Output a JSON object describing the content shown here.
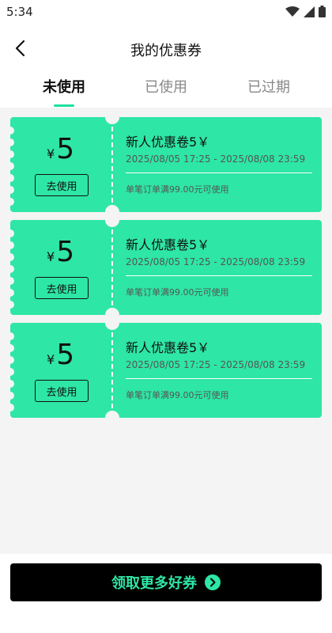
{
  "status_bar": {
    "time": "5:34"
  },
  "header": {
    "title": "我的优惠券"
  },
  "tabs": [
    {
      "label": "未使用",
      "active": true
    },
    {
      "label": "已使用",
      "active": false
    },
    {
      "label": "已过期",
      "active": false
    }
  ],
  "coupons": [
    {
      "currency": "¥",
      "amount": "5",
      "use_label": "去使用",
      "title": "新人优惠卷5￥",
      "validity": "2025/08/05 17:25 - 2025/08/08 23:59",
      "condition": "单笔订单满99.00元可使用"
    },
    {
      "currency": "¥",
      "amount": "5",
      "use_label": "去使用",
      "title": "新人优惠卷5￥",
      "validity": "2025/08/05 17:25 - 2025/08/08 23:59",
      "condition": "单笔订单满99.00元可使用"
    },
    {
      "currency": "¥",
      "amount": "5",
      "use_label": "去使用",
      "title": "新人优惠卷5￥",
      "validity": "2025/08/05 17:25 - 2025/08/08 23:59",
      "condition": "单笔订单满99.00元可使用"
    }
  ],
  "footer": {
    "more_label": "领取更多好券",
    "icon": "chevron-right-icon"
  },
  "colors": {
    "accent": "#2ee6a5",
    "tab_indicator": "#1ddf9f",
    "background": "#f4f4f4"
  },
  "icons": {
    "status": [
      "wifi-icon",
      "signal-icon",
      "battery-icon"
    ],
    "back": "back-arrow-icon"
  }
}
